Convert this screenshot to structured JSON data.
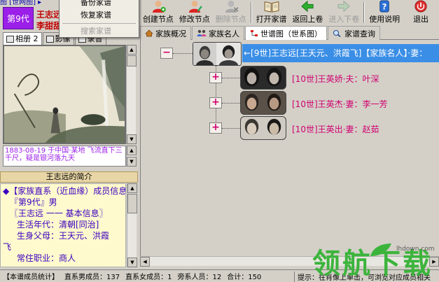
{
  "menu_fragment": "图 [世网图] ▸",
  "dropdown": {
    "items": [
      {
        "label": "备份家谱",
        "disabled": false
      },
      {
        "label": "恢复家谱",
        "disabled": false
      },
      {
        "label": "搜索家谱",
        "disabled": true
      }
    ]
  },
  "person": {
    "generation": "第9代",
    "name": "王志远",
    "spouse": "李甜甜"
  },
  "left_tabs": [
    {
      "label": "相册 2",
      "icon": "album-icon"
    },
    {
      "label": "影像",
      "icon": "video-icon"
    },
    {
      "label": "录音",
      "icon": "audio-icon"
    }
  ],
  "photo_caption": "1883-08-19 于中国·某地 飞流直下三千尺，疑是银河落九天",
  "intro": {
    "title": "王志远的简介",
    "lines": [
      "◆【家族直系（近血缘）成员信息】",
      "『第9代』男",
      "〖王志远 一一 基本信息〗",
      "生活年代：清朝[同治]",
      "生身父母：王天元、洪霞",
      "飞",
      "常住职业：商人"
    ]
  },
  "toolbar": [
    {
      "label": "创建节点",
      "icon": "create-node-icon",
      "disabled": false
    },
    {
      "label": "修改节点",
      "icon": "edit-node-icon",
      "disabled": false
    },
    {
      "label": "删除节点",
      "icon": "delete-node-icon",
      "disabled": true
    },
    {
      "label": "打开家谱",
      "icon": "open-book-icon",
      "disabled": false
    },
    {
      "label": "返回上卷",
      "icon": "back-arrow-icon",
      "disabled": false
    },
    {
      "label": "进入下卷",
      "icon": "forward-arrow-icon",
      "disabled": true
    },
    {
      "label": "使用说明",
      "icon": "help-icon",
      "disabled": false
    },
    {
      "label": "退出",
      "icon": "exit-icon",
      "disabled": false
    }
  ],
  "main_tabs": [
    {
      "label": "家族概况",
      "icon": "home-icon",
      "active": false
    },
    {
      "label": "家族名人",
      "icon": "people-icon",
      "active": false
    },
    {
      "label": "世谱图（世系图）",
      "icon": "tree-icon",
      "active": true
    },
    {
      "label": "家谱查询",
      "icon": "search-icon",
      "active": false
    }
  ],
  "tree": {
    "root": {
      "expander": "−",
      "label": "←[9世]王志远[王天元、洪霞飞]【家族名人】·妻："
    },
    "children": [
      {
        "expander": "+",
        "label": "[10世]王英娇·夫：叶深"
      },
      {
        "expander": "+",
        "label": "[10世]王英杰·妻：李一芳"
      },
      {
        "expander": "+",
        "label": "[10世]王英出·妻：赵茹"
      }
    ]
  },
  "status": {
    "stat_label": "【本谱成员统计】",
    "male": "直系男成员：137",
    "female": "直系女成员：1",
    "side": "旁系人员：12",
    "total": "合计：150",
    "hint": "提示：在肖像上单击，可浏览对应成员相关"
  },
  "watermark": {
    "text": "领航下载",
    "url": "lhdown.com"
  },
  "colors": {
    "generation_badge": "#9b1fe8",
    "name_red": "#c00000",
    "tree_label": "#d00070",
    "root_highlight": "#3a8ee6",
    "intro_bg": "#fffacd",
    "watermark_green": "#3cb43c"
  }
}
